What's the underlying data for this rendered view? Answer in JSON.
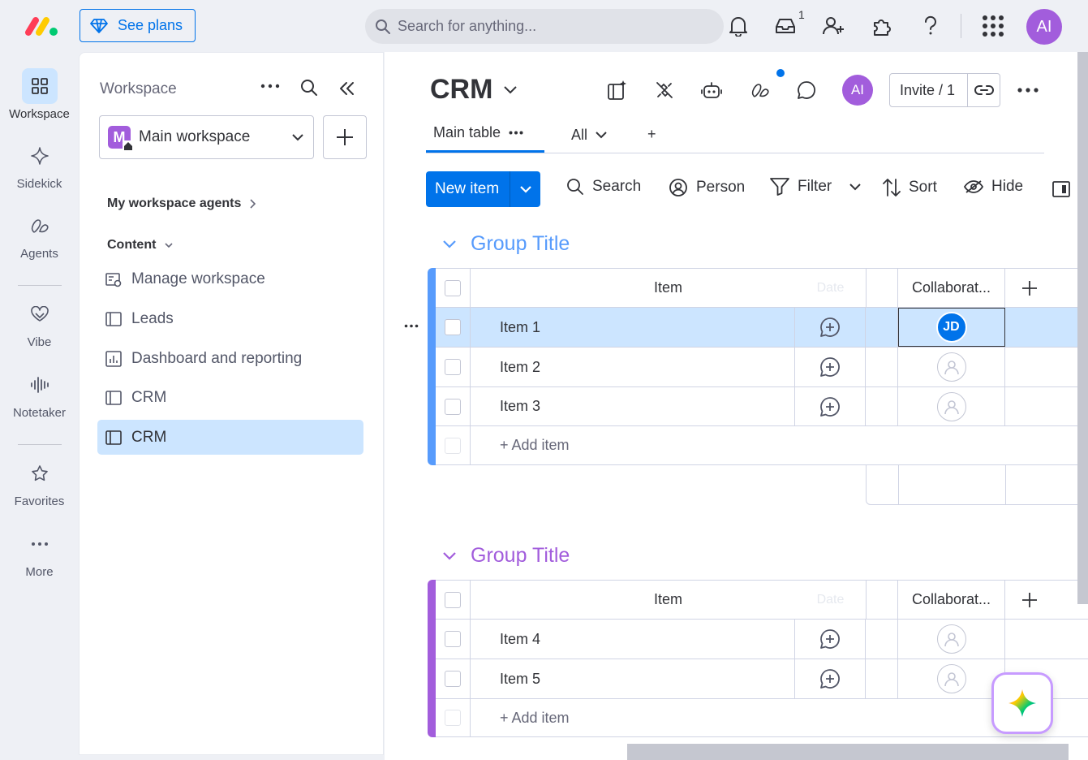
{
  "topbar": {
    "see_plans": "See plans",
    "search_placeholder": "Search for anything...",
    "inbox_count": "1",
    "user_initials": "AI"
  },
  "rail": {
    "items": [
      {
        "label": "Workspace"
      },
      {
        "label": "Sidekick"
      },
      {
        "label": "Agents"
      },
      {
        "label": "Vibe"
      },
      {
        "label": "Notetaker"
      },
      {
        "label": "Favorites"
      },
      {
        "label": "More"
      }
    ]
  },
  "workspace": {
    "title": "Workspace",
    "selected": "Main workspace",
    "selected_initial": "M",
    "agents_label": "My workspace agents",
    "content_label": "Content",
    "links": [
      {
        "label": "Manage workspace"
      },
      {
        "label": "Leads"
      },
      {
        "label": "Dashboard and reporting"
      },
      {
        "label": "CRM"
      },
      {
        "label": "CRM"
      }
    ]
  },
  "board": {
    "title": "CRM",
    "avatar_initials": "AI",
    "invite": "Invite / 1",
    "tabs": [
      {
        "label": "Main table"
      },
      {
        "label": "All"
      },
      {
        "label": "+"
      }
    ],
    "toolbar": {
      "new_item": "New item",
      "search": "Search",
      "person": "Person",
      "filter": "Filter",
      "sort": "Sort",
      "hide": "Hide"
    },
    "columns": {
      "item": "Item",
      "date": "Date",
      "collaborators": "Collaborat..."
    },
    "groups": [
      {
        "title": "Group Title",
        "color": "#579bfc",
        "items": [
          {
            "name": "Item 1",
            "collaborator": "JD"
          },
          {
            "name": "Item 2",
            "collaborator": ""
          },
          {
            "name": "Item 3",
            "collaborator": ""
          }
        ],
        "add_item": "+ Add item"
      },
      {
        "title": "Group Title",
        "color": "#a25ddc",
        "items": [
          {
            "name": "Item 4",
            "collaborator": ""
          },
          {
            "name": "Item 5",
            "collaborator": ""
          }
        ],
        "add_item": "+ Add item"
      }
    ]
  },
  "colors": {
    "accent": "#0073ea",
    "selected_row": "#cce5ff",
    "group1": "#579bfc",
    "group2": "#a25ddc"
  }
}
